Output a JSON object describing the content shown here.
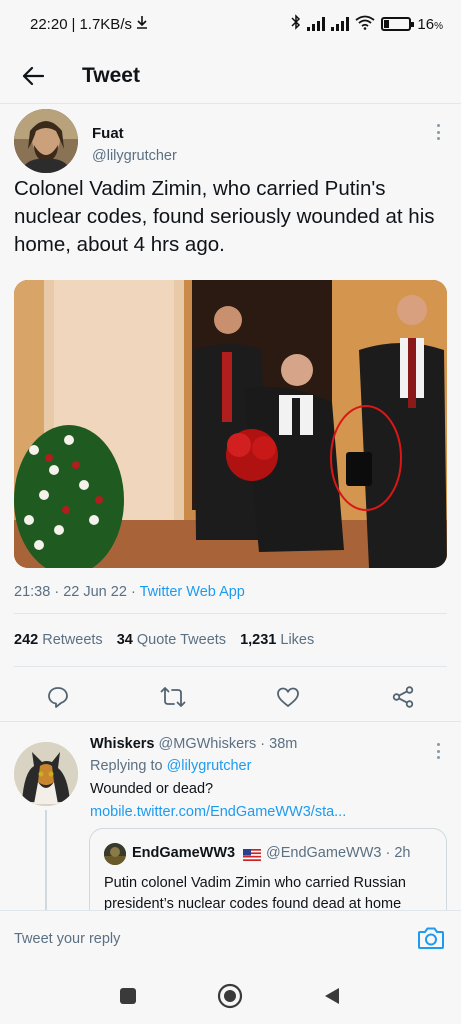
{
  "status_bar": {
    "time": "22:20",
    "speed": "1.7KB/s",
    "battery": "16"
  },
  "header": {
    "title": "Tweet"
  },
  "tweet": {
    "author_name": "Fuat",
    "author_handle": "@lilygrutcher",
    "text": "Colonel Vadim Zimin, who carried Putin's nuclear codes, found seriously wounded at his home, about 4 hrs ago.",
    "time": "21:38",
    "date": "22 Jun 22",
    "source": "Twitter Web App",
    "retweets_count": "242",
    "retweets_label": "Retweets",
    "quotes_count": "34",
    "quotes_label": "Quote Tweets",
    "likes_count": "1,231",
    "likes_label": "Likes"
  },
  "reply": {
    "name": "Whiskers",
    "handle": "@MGWhiskers",
    "time": "38m",
    "replying_prefix": "Replying to",
    "replying_to": "@lilygrutcher",
    "text": "Wounded or dead?",
    "link": "mobile.twitter.com/EndGameWW3/sta...",
    "quote": {
      "name": "EndGameWW3",
      "handle": "@EndGameWW3",
      "time": "2h",
      "text": "Putin colonel Vadim Zimin who carried Russian president’s nuclear codes found dead at home"
    }
  },
  "compose": {
    "placeholder": "Tweet your reply"
  },
  "colors": {
    "accent": "#1d9bf0",
    "secondary_text": "#5b7083",
    "background": "#f7f7f7"
  }
}
